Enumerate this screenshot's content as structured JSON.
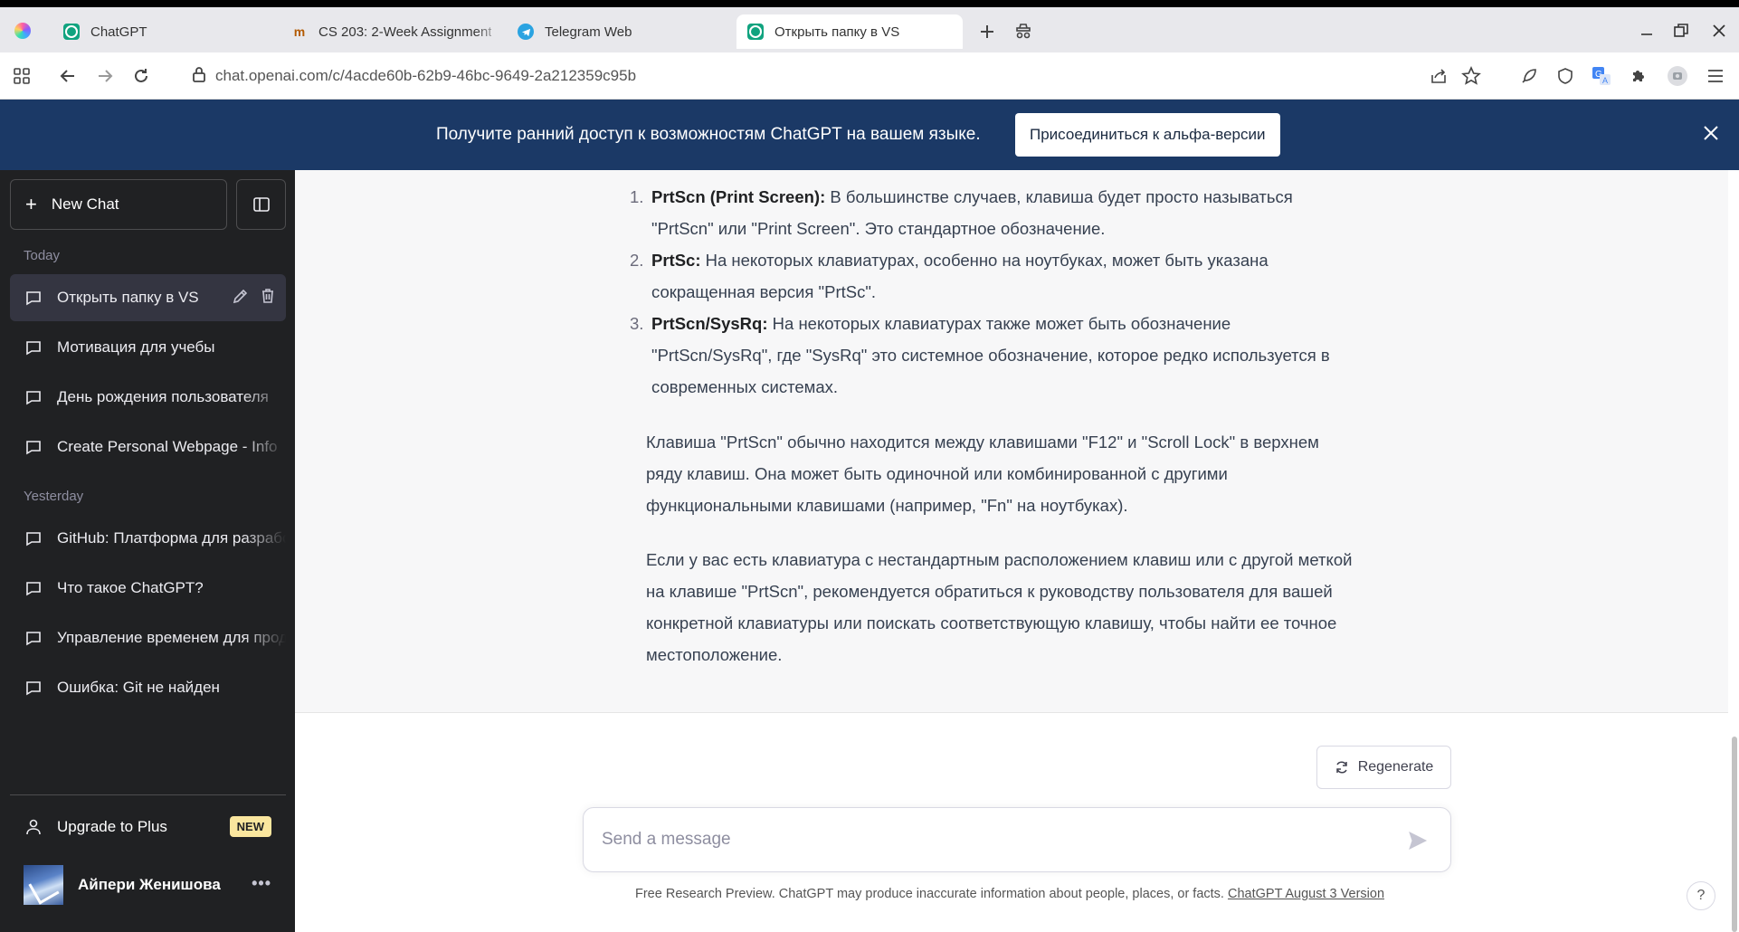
{
  "browser": {
    "tabs": [
      {
        "title": "ChatGPT",
        "icon": "chatgpt-icon",
        "active": false
      },
      {
        "title": "CS 203: 2-Week Assignment",
        "icon": "course-icon",
        "active": false
      },
      {
        "title": "Telegram Web",
        "icon": "telegram-icon",
        "active": false
      },
      {
        "title": "Открыть папку в VS",
        "icon": "chatgpt-icon",
        "active": true
      }
    ],
    "url": "chat.openai.com/c/4acde60b-62b9-46bc-9649-2a212359c95b"
  },
  "banner": {
    "text": "Получите ранний доступ к возможностям ChatGPT на вашем языке.",
    "button_label": "Присоединиться к альфа-версии"
  },
  "sidebar": {
    "new_chat_label": "New Chat",
    "sections": [
      {
        "heading": "Today",
        "items": [
          {
            "label": "Открыть папку в VS",
            "active": true
          },
          {
            "label": "Мотивация для учебы"
          },
          {
            "label": "День рождения пользователя"
          },
          {
            "label": "Create Personal Webpage - Info"
          }
        ]
      },
      {
        "heading": "Yesterday",
        "items": [
          {
            "label": "GitHub: Платформа для разработки"
          },
          {
            "label": "Что такое ChatGPT?"
          },
          {
            "label": "Управление временем для продуктивности"
          },
          {
            "label": "Ошибка: Git не найден"
          }
        ]
      }
    ],
    "upgrade_label": "Upgrade to Plus",
    "upgrade_badge": "NEW",
    "user_name": "Айпери Женишова"
  },
  "conversation": {
    "list": [
      {
        "num": "1.",
        "term": "PrtScn (Print Screen):",
        "line1": " В большинстве случаев, клавиша будет просто называться",
        "line2": "\"PrtScn\" или \"Print Screen\". Это стандартное обозначение."
      },
      {
        "num": "2.",
        "term": "PrtSc:",
        "line1": " На некоторых клавиатурах, особенно на ноутбуках, может быть указана",
        "line2": "сокращенная версия \"PrtSc\"."
      },
      {
        "num": "3.",
        "term": "PrtScn/SysRq:",
        "line1": " На некоторых клавиатурах также может быть обозначение",
        "line2": "\"PrtScn/SysRq\", где \"SysRq\" это системное обозначение, которое редко используется в",
        "line3": "современных системах."
      }
    ],
    "paragraph1": [
      "Клавиша \"PrtScn\" обычно находится между клавишами \"F12\" и \"Scroll Lock\" в верхнем",
      "ряду клавиш. Она может быть одиночной или комбинированной с другими",
      "функциональными клавишами (например, \"Fn\" на ноутбуках)."
    ],
    "paragraph2": [
      "Если у вас есть клавиатура с нестандартным расположением клавиш или с другой меткой",
      "на клавише \"PrtScn\", рекомендуется обратиться к руководству пользователя для вашей",
      "конкретной клавиатуры или поискать соответствующую клавишу, чтобы найти ее точное",
      "местоположение."
    ]
  },
  "composer": {
    "regenerate_label": "Regenerate",
    "placeholder": "Send a message",
    "footnote": "Free Research Preview. ChatGPT may produce inaccurate information about people, places, or facts. ",
    "footnote_link": "ChatGPT August 3 Version",
    "help_label": "?"
  },
  "colors": {
    "banner_bg": "#1b3966",
    "sidebar_bg": "#202123",
    "accent": "#10a37f"
  }
}
